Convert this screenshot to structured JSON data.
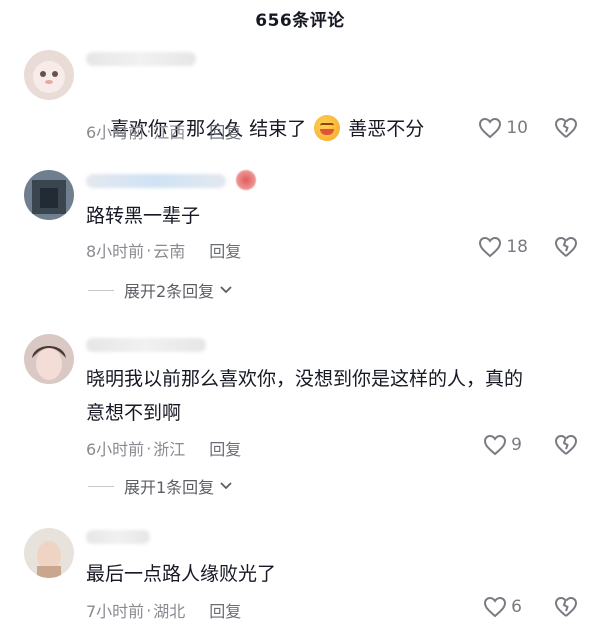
{
  "header": {
    "title": "656条评论"
  },
  "comments": [
    {
      "text_a": "喜欢你了那么久 结束了",
      "text_b": "善恶不分",
      "emoji_icon": "face-with-tears-emoji",
      "time": "6小时前",
      "location": "江西",
      "reply": "回复",
      "likes": "10"
    },
    {
      "text": "路转黑一辈子",
      "time": "8小时前",
      "location": "云南",
      "reply": "回复",
      "likes": "18",
      "expand": "展开2条回复"
    },
    {
      "text": "晓明我以前那么喜欢你，没想到你是这样的人，真的\n意想不到啊",
      "time": "6小时前",
      "location": "浙江",
      "reply": "回复",
      "likes": "9",
      "expand": "展开1条回复"
    },
    {
      "text": "最后一点路人缘败光了",
      "time": "7小时前",
      "location": "湖北",
      "reply": "回复",
      "likes": "6"
    }
  ],
  "meta_separator": "·",
  "icons": {
    "like": "heart-outline-icon",
    "dislike": "broken-heart-icon",
    "chevron": "chevron-down-icon"
  }
}
